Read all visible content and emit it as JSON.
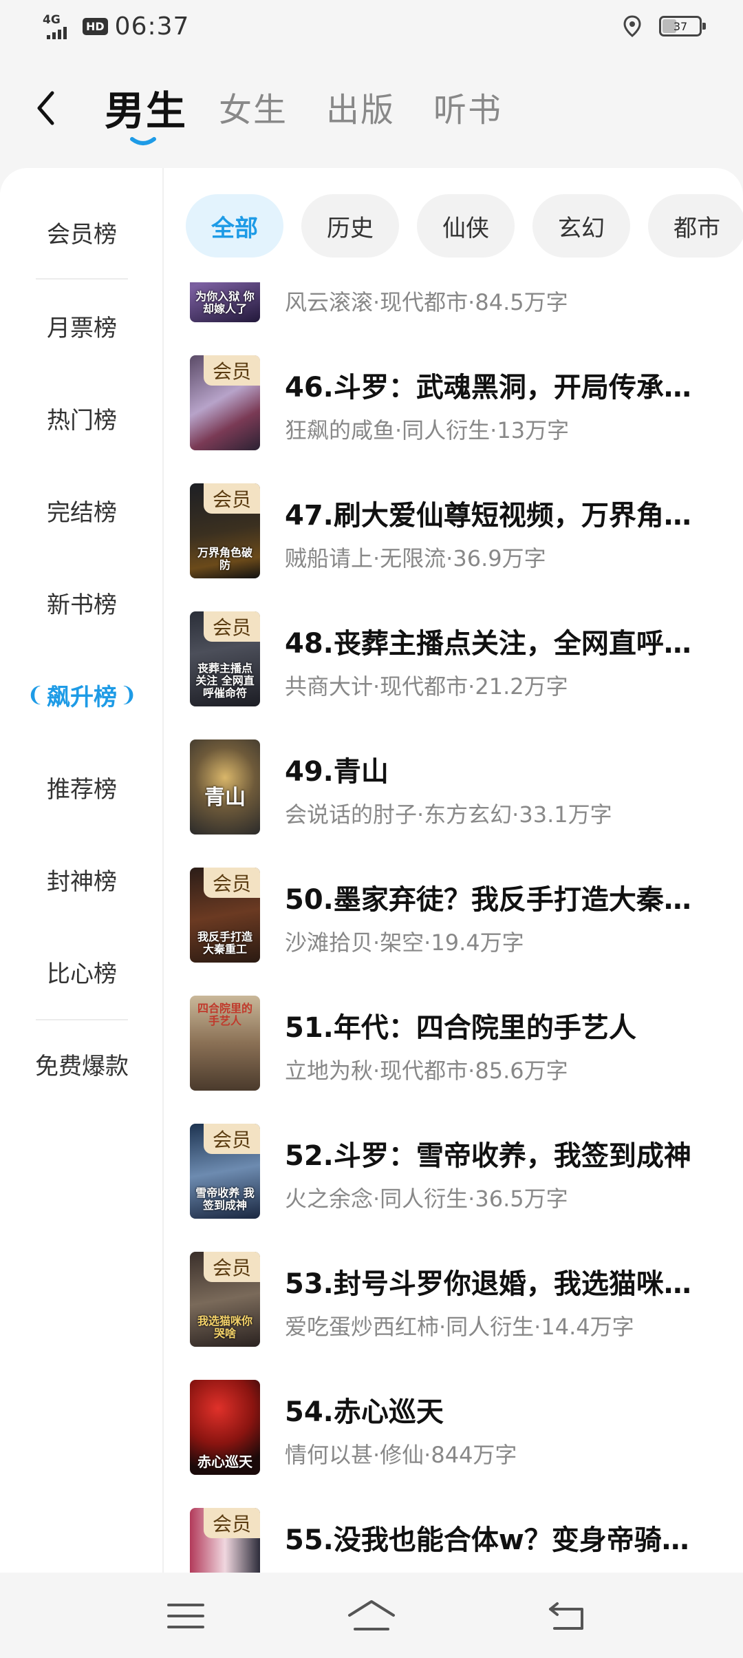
{
  "status_bar": {
    "network": "4G",
    "hd_label": "HD",
    "time": "06:37",
    "battery": "37"
  },
  "header": {
    "tabs": [
      {
        "label": "男生"
      },
      {
        "label": "女生"
      },
      {
        "label": "出版"
      },
      {
        "label": "听书"
      }
    ],
    "active_tab": "男生",
    "accent_color": "#1e9be6"
  },
  "sidebar": {
    "items": [
      {
        "label": "会员榜"
      },
      {
        "label": "月票榜"
      },
      {
        "label": "热门榜"
      },
      {
        "label": "完结榜"
      },
      {
        "label": "新书榜"
      },
      {
        "label": "飙升榜"
      },
      {
        "label": "推荐榜"
      },
      {
        "label": "封神榜"
      },
      {
        "label": "比心榜"
      },
      {
        "label": "免费爆款"
      }
    ],
    "active": "飙升榜"
  },
  "filters": {
    "chips": [
      {
        "label": "全部"
      },
      {
        "label": "历史"
      },
      {
        "label": "仙侠"
      },
      {
        "label": "玄幻"
      },
      {
        "label": "都市"
      }
    ],
    "active": "全部"
  },
  "badge_label": "会员",
  "books": [
    {
      "title": "",
      "meta": "风云滚滚·现代都市·84.5万字",
      "vip": false,
      "cover_text": "为你入狱 你却嫁人了"
    },
    {
      "title": "46.斗罗：武魂黑洞，开局传承…",
      "meta": "狂飙的咸鱼·同人衍生·13万字",
      "vip": true,
      "cover_text": ""
    },
    {
      "title": "47.刷大爱仙尊短视频，万界角…",
      "meta": "贼船请上·无限流·36.9万字",
      "vip": true,
      "cover_text": "万界角色破防"
    },
    {
      "title": "48.丧葬主播点关注，全网直呼…",
      "meta": "共商大计·现代都市·21.2万字",
      "vip": true,
      "cover_text": "丧葬主播点关注 全网直呼催命符"
    },
    {
      "title": "49.青山",
      "meta": "会说话的肘子·东方玄幻·33.1万字",
      "vip": false,
      "cover_text": "青山"
    },
    {
      "title": "50.墨家弃徒？我反手打造大秦…",
      "meta": "沙滩拾贝·架空·19.4万字",
      "vip": true,
      "cover_text": "我反手打造大秦重工"
    },
    {
      "title": "51.年代：四合院里的手艺人",
      "meta": "立地为秋·现代都市·85.6万字",
      "vip": false,
      "cover_text": "四合院里的手艺人"
    },
    {
      "title": "52.斗罗：雪帝收养，我签到成神",
      "meta": "火之余念·同人衍生·36.5万字",
      "vip": true,
      "cover_text": "雪帝收养 我签到成神"
    },
    {
      "title": "53.封号斗罗你退婚，我选猫咪…",
      "meta": "爱吃蛋炒西红柿·同人衍生·14.4万字",
      "vip": true,
      "cover_text": "我选猫咪你哭啥"
    },
    {
      "title": "54.赤心巡天",
      "meta": "情何以甚·修仙·844万字",
      "vip": false,
      "cover_text": "赤心巡天"
    },
    {
      "title": "55.没我也能合体w？变身帝骑…",
      "meta": "",
      "vip": true,
      "cover_text": ""
    }
  ]
}
